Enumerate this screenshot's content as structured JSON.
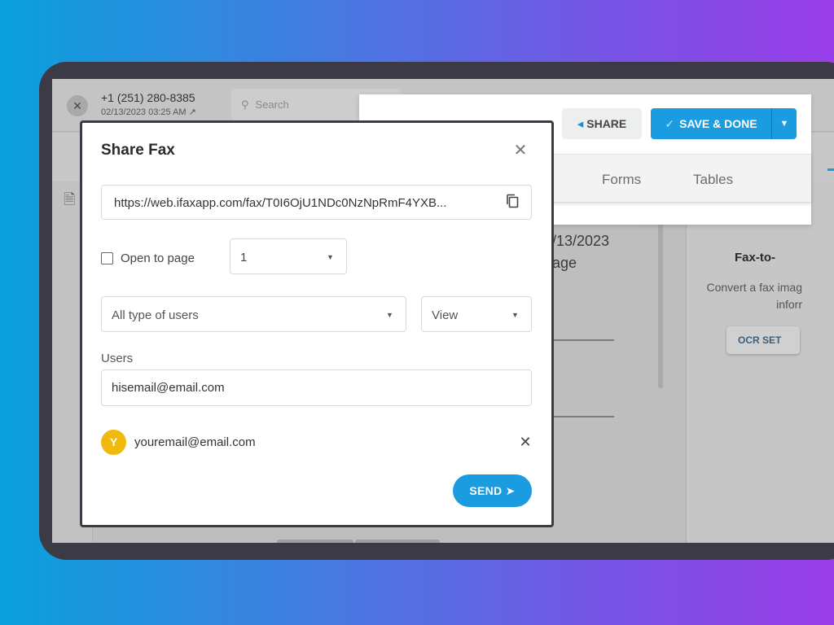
{
  "background_app": {
    "phone_number": "+1 (251) 280-8385",
    "date": "02/13/2023 03:25 AM",
    "date_icon": "arrow-up-right-icon",
    "search_placeholder": "Search",
    "page_text_line1": "/13/2023",
    "page_text_line2": "age",
    "ocr_panel": {
      "title": "Fax-to-",
      "desc_line1": "Convert a fax imag",
      "desc_line2": "inforr",
      "button": "OCR SET"
    }
  },
  "toolbar": {
    "share_label": "SHARE",
    "save_label": "SAVE & DONE",
    "tabs": [
      "Forms",
      "Tables"
    ],
    "accent_color": "#1b9be0"
  },
  "modal": {
    "title": "Share Fax",
    "link_url": "https://web.ifaxapp.com/fax/T0I6OjU1NDc0NzNpRmF4YXB...",
    "open_to_page_label": "Open to page",
    "open_to_page_checked": false,
    "page_value": "1",
    "user_type_value": "All type of users",
    "permission_value": "View",
    "users_label": "Users",
    "users_input_value": "hisemail@email.com",
    "shared_users": [
      {
        "initial": "Y",
        "email": "youremail@email.com",
        "avatar_color": "#f0b90c"
      }
    ],
    "send_label": "SEND"
  }
}
